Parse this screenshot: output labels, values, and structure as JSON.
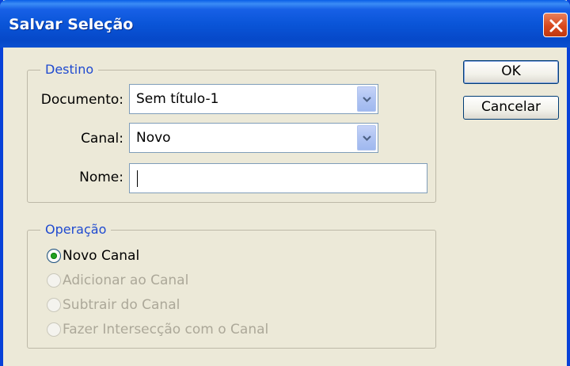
{
  "dialog": {
    "title": "Salvar Seleção"
  },
  "destino": {
    "legend": "Destino",
    "documento_label": "Documento:",
    "documento_value": "Sem título-1",
    "canal_label": "Canal:",
    "canal_value": "Novo",
    "nome_label": "Nome:",
    "nome_value": ""
  },
  "operacao": {
    "legend": "Operação",
    "options": [
      {
        "label": "Novo Canal",
        "selected": true,
        "enabled": true
      },
      {
        "label": "Adicionar ao Canal",
        "selected": false,
        "enabled": false
      },
      {
        "label": "Subtrair do Canal",
        "selected": false,
        "enabled": false
      },
      {
        "label": "Fazer Intersecção com o Canal",
        "selected": false,
        "enabled": false
      }
    ]
  },
  "buttons": {
    "ok": "OK",
    "cancel": "Cancelar"
  },
  "colors": {
    "titlebar": "#0a55d8",
    "dialog_bg": "#ece9d8",
    "legend_text": "#1f4ad0",
    "radio_dot": "#21a121",
    "disabled_text": "#aca899"
  }
}
